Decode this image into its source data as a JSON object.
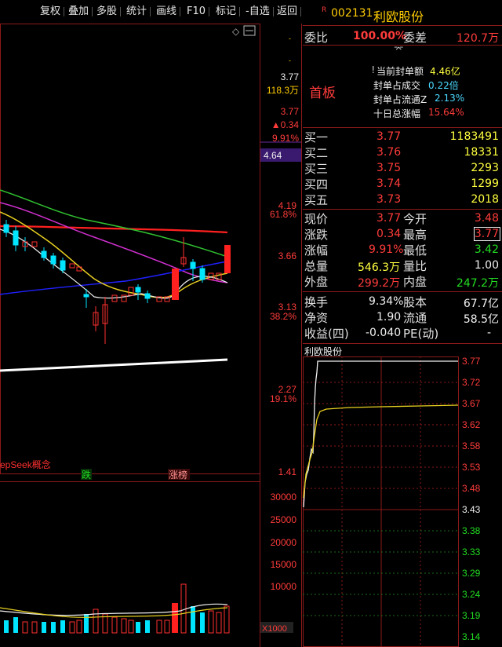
{
  "toolbar": {
    "items": [
      "复权",
      "叠加",
      "多股",
      "统计",
      "画线",
      "F10",
      "标记",
      "-自选",
      "返回"
    ]
  },
  "kchart": {
    "price_axis": [
      "3.77",
      "118.3万",
      "3.77",
      "▲0.34",
      "9.91%",
      "4.64",
      "4.19",
      "61.8%",
      "3.66",
      "3.13",
      "38.2%",
      "2.27",
      "19.1%",
      "1.41"
    ],
    "concept_label": "epSeek概念",
    "tag_die": "跌",
    "tag_zhangbang": "涨榜",
    "vol_axis": [
      "30000",
      "25000",
      "20000",
      "15000",
      "10000",
      "X1000"
    ]
  },
  "stock": {
    "flag": "R",
    "code": "002131",
    "name": "利欧股份",
    "weibi_label": "委比",
    "weibi_value": "100.00%",
    "weicha_label": "委差",
    "weicha_value": "120.7万",
    "board": "首板",
    "seal_amount_label": "当前封单额",
    "seal_amount": "4.46亿",
    "seal_deal_label": "封单占成交",
    "seal_deal": "0.22倍",
    "seal_float_label": "封单占流通Z",
    "seal_float": "2.13%",
    "ten_day_label": "十日总涨幅",
    "ten_day": "15.64%"
  },
  "bids": [
    {
      "label": "买一",
      "price": "3.77",
      "vol": "1183491"
    },
    {
      "label": "买二",
      "price": "3.76",
      "vol": "18331"
    },
    {
      "label": "买三",
      "price": "3.75",
      "vol": "2293"
    },
    {
      "label": "买四",
      "price": "3.74",
      "vol": "1299"
    },
    {
      "label": "买五",
      "price": "3.73",
      "vol": "2018"
    }
  ],
  "quote": {
    "xianjia_label": "现价",
    "xianjia": "3.77",
    "jinkai_label": "今开",
    "jinkai": "3.48",
    "zhangdie_label": "涨跌",
    "zhangdie": "0.34",
    "zuigao_label": "最高",
    "zuigao": "3.77",
    "zhangfu_label": "涨幅",
    "zhangfu": "9.91%",
    "zuidi_label": "最低",
    "zuidi": "3.42",
    "zongliang_label": "总量",
    "zongliang": "546.3万",
    "liangbi_label": "量比",
    "liangbi": "1.00",
    "waipan_label": "外盘",
    "waipan": "299.2万",
    "neipan_label": "内盘",
    "neipan": "247.2万",
    "huanshou_label": "换手",
    "huanshou": "9.34%",
    "guben_label": "股本",
    "guben": "67.7亿",
    "jingzi_label": "净资",
    "jingzi": "1.90",
    "liutong_label": "流通",
    "liutong": "58.5亿",
    "shouyi_label": "收益(四)",
    "shouyi": "-0.040",
    "pe_label": "PE(动)",
    "pe": "-"
  },
  "intraday": {
    "title": "利欧股份",
    "price_levels": [
      "3.77",
      "3.72",
      "3.67",
      "3.62",
      "3.58",
      "3.53",
      "3.48",
      "3.43",
      "3.38",
      "3.33",
      "3.29",
      "3.24",
      "3.19",
      "3.14"
    ]
  }
}
